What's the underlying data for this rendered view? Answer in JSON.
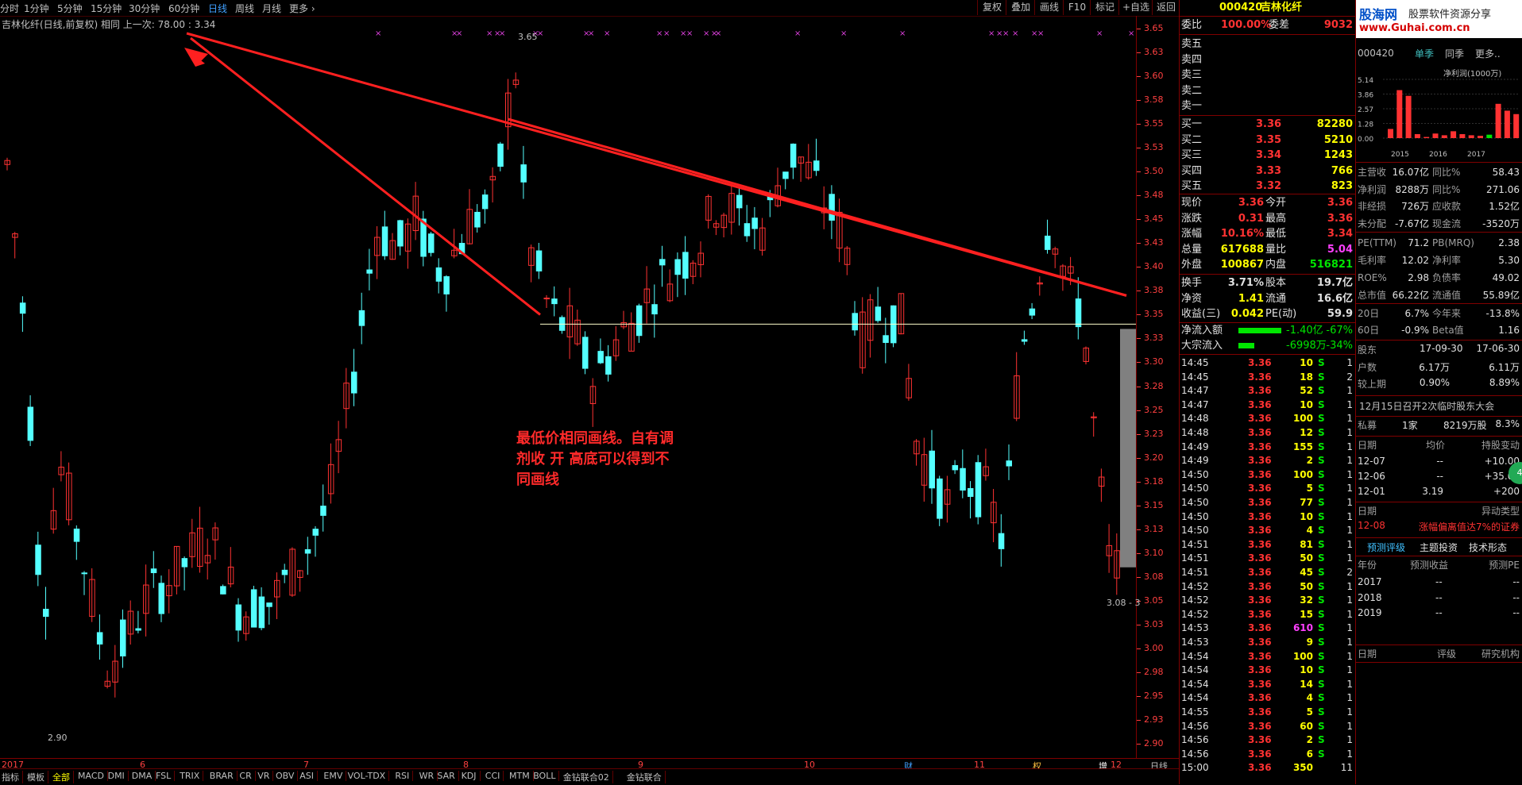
{
  "toolbar": {
    "periods": [
      "分时",
      "1分钟",
      "5分钟",
      "15分钟",
      "30分钟",
      "60分钟",
      "日线",
      "周线",
      "月线",
      "更多"
    ],
    "active_period": "日线",
    "buttons": [
      "复权",
      "叠加",
      "画线",
      "F10",
      "标记",
      "+自选",
      "返回"
    ]
  },
  "chart": {
    "info": "吉林化纤(日线,前复权) 相同 上一次: 78.00 : 3.34",
    "high_label": "3.65",
    "low_label": "2.90",
    "box_label": "3.08 - 3",
    "annotation": "最低价相同画线。自有调剂收 开 高底可以得到不同画线",
    "y_axis": [
      "3.65",
      "3.63",
      "3.60",
      "3.58",
      "3.55",
      "3.53",
      "3.50",
      "3.48",
      "3.45",
      "3.43",
      "3.40",
      "3.38",
      "3.35",
      "3.33",
      "3.30",
      "3.28",
      "3.25",
      "3.23",
      "3.20",
      "3.18",
      "3.15",
      "3.13",
      "3.10",
      "3.08",
      "3.05",
      "3.03",
      "3.00",
      "2.98",
      "2.95",
      "2.93",
      "2.90"
    ],
    "x_axis": [
      "2017年",
      "6",
      "7",
      "8",
      "9",
      "10",
      "11",
      "12"
    ],
    "x_markers": [
      "财",
      "权",
      "增减"
    ],
    "corner_label": "日线",
    "colors": {
      "up": "#ff3232",
      "down": "#54ffff",
      "trendline": "#ff2020",
      "hline": "#ffffcc"
    }
  },
  "indicators": [
    "指标",
    "模板",
    "全部",
    "MACD",
    "DMI",
    "DMA",
    "FSL",
    "TRIX",
    "BRAR",
    "CR",
    "VR",
    "OBV",
    "ASI",
    "EMV",
    "VOL-TDX",
    "RSI",
    "WR",
    "SAR",
    "KDJ",
    "CCI",
    "MTM",
    "BOLL",
    "金钻联合02",
    "金钻联合"
  ],
  "quote": {
    "code": "000420",
    "name": "吉林化纤",
    "webi_label": "委比",
    "webi_value": "100.00%",
    "wecha_label": "委差",
    "wecha_value": "9032",
    "sells": [
      {
        "label": "卖五"
      },
      {
        "label": "卖四"
      },
      {
        "label": "卖三"
      },
      {
        "label": "卖二"
      },
      {
        "label": "卖一"
      }
    ],
    "buys": [
      {
        "label": "买一",
        "price": "3.36",
        "vol": "82280"
      },
      {
        "label": "买二",
        "price": "3.35",
        "vol": "5210"
      },
      {
        "label": "买三",
        "price": "3.34",
        "vol": "1243"
      },
      {
        "label": "买四",
        "price": "3.33",
        "vol": "766"
      },
      {
        "label": "买五",
        "price": "3.32",
        "vol": "823"
      }
    ],
    "stats": [
      {
        "l1": "现价",
        "v1": "3.36",
        "l2": "今开",
        "v2": "3.36"
      },
      {
        "l1": "涨跌",
        "v1": "0.31",
        "l2": "最高",
        "v2": "3.36"
      },
      {
        "l1": "涨幅",
        "v1": "10.16%",
        "l2": "最低",
        "v2": "3.34"
      },
      {
        "l1": "总量",
        "v1": "617688",
        "l2": "量比",
        "v2": "5.04"
      },
      {
        "l1": "外盘",
        "v1": "100867",
        "l2": "内盘",
        "v2": "516821"
      }
    ],
    "stats2": [
      {
        "l1": "换手",
        "v1": "3.71%",
        "l2": "股本",
        "v2": "19.7亿"
      },
      {
        "l1": "净资",
        "v1": "1.41",
        "l2": "流通",
        "v2": "16.6亿"
      },
      {
        "l1": "收益(三)",
        "v1": "0.042",
        "l2": "PE(动)",
        "v2": "59.9"
      }
    ],
    "flow": [
      {
        "label": "净流入额",
        "value": "-1.40亿",
        "pct": "-67%"
      },
      {
        "label": "大宗流入",
        "value": "-6998万",
        "pct": "-34%"
      }
    ],
    "ticks": [
      {
        "t": "14:45",
        "p": "3.36",
        "v": "10",
        "s": "S",
        "n": "1"
      },
      {
        "t": "14:45",
        "p": "3.36",
        "v": "18",
        "s": "S",
        "n": "2"
      },
      {
        "t": "14:47",
        "p": "3.36",
        "v": "52",
        "s": "S",
        "n": "1"
      },
      {
        "t": "14:47",
        "p": "3.36",
        "v": "10",
        "s": "S",
        "n": "1"
      },
      {
        "t": "14:48",
        "p": "3.36",
        "v": "100",
        "s": "S",
        "n": "1"
      },
      {
        "t": "14:48",
        "p": "3.36",
        "v": "12",
        "s": "S",
        "n": "1"
      },
      {
        "t": "14:49",
        "p": "3.36",
        "v": "155",
        "s": "S",
        "n": "1"
      },
      {
        "t": "14:49",
        "p": "3.36",
        "v": "2",
        "s": "S",
        "n": "1"
      },
      {
        "t": "14:50",
        "p": "3.36",
        "v": "100",
        "s": "S",
        "n": "1"
      },
      {
        "t": "14:50",
        "p": "3.36",
        "v": "5",
        "s": "S",
        "n": "1"
      },
      {
        "t": "14:50",
        "p": "3.36",
        "v": "77",
        "s": "S",
        "n": "1"
      },
      {
        "t": "14:50",
        "p": "3.36",
        "v": "10",
        "s": "S",
        "n": "1"
      },
      {
        "t": "14:50",
        "p": "3.36",
        "v": "4",
        "s": "S",
        "n": "1"
      },
      {
        "t": "14:51",
        "p": "3.36",
        "v": "81",
        "s": "S",
        "n": "1"
      },
      {
        "t": "14:51",
        "p": "3.36",
        "v": "50",
        "s": "S",
        "n": "1"
      },
      {
        "t": "14:51",
        "p": "3.36",
        "v": "45",
        "s": "S",
        "n": "2"
      },
      {
        "t": "14:52",
        "p": "3.36",
        "v": "50",
        "s": "S",
        "n": "1"
      },
      {
        "t": "14:52",
        "p": "3.36",
        "v": "32",
        "s": "S",
        "n": "1"
      },
      {
        "t": "14:52",
        "p": "3.36",
        "v": "15",
        "s": "S",
        "n": "1"
      },
      {
        "t": "14:53",
        "p": "3.36",
        "v": "610",
        "s": "S",
        "n": "1"
      },
      {
        "t": "14:53",
        "p": "3.36",
        "v": "9",
        "s": "S",
        "n": "1"
      },
      {
        "t": "14:54",
        "p": "3.36",
        "v": "100",
        "s": "S",
        "n": "1"
      },
      {
        "t": "14:54",
        "p": "3.36",
        "v": "10",
        "s": "S",
        "n": "1"
      },
      {
        "t": "14:54",
        "p": "3.36",
        "v": "14",
        "s": "S",
        "n": "1"
      },
      {
        "t": "14:54",
        "p": "3.36",
        "v": "4",
        "s": "S",
        "n": "1"
      },
      {
        "t": "14:55",
        "p": "3.36",
        "v": "5",
        "s": "S",
        "n": "1"
      },
      {
        "t": "14:56",
        "p": "3.36",
        "v": "60",
        "s": "S",
        "n": "1"
      },
      {
        "t": "14:56",
        "p": "3.36",
        "v": "2",
        "s": "S",
        "n": "1"
      },
      {
        "t": "14:56",
        "p": "3.36",
        "v": "6",
        "s": "S",
        "n": "1"
      },
      {
        "t": "15:00",
        "p": "3.36",
        "v": "350",
        "s": "",
        "n": "11"
      }
    ]
  },
  "f10": {
    "logo_site": "股海网",
    "logo_slogan": "股票软件资源分享",
    "logo_url": "www.Guhai.com.cn",
    "code": "000420",
    "tabs": [
      "单季",
      "同季",
      "更多.."
    ],
    "chart_title": "净利润(1000万)",
    "chart_y": [
      "5.14",
      "3.86",
      "2.57",
      "1.28",
      "0.00"
    ],
    "chart_x": [
      "2015",
      "2016",
      "2017"
    ],
    "bars": [
      {
        "v": 0.8,
        "c": "#ff3232"
      },
      {
        "v": 4.2,
        "c": "#ff3232"
      },
      {
        "v": 3.7,
        "c": "#ff3232"
      },
      {
        "v": 0.35,
        "c": "#ff3232"
      },
      {
        "v": 0.1,
        "c": "#ff3232"
      },
      {
        "v": 0.4,
        "c": "#ff3232"
      },
      {
        "v": 0.25,
        "c": "#ff3232"
      },
      {
        "v": 0.6,
        "c": "#ff3232"
      },
      {
        "v": 0.35,
        "c": "#ff3232"
      },
      {
        "v": 0.25,
        "c": "#ff3232"
      },
      {
        "v": 0.2,
        "c": "#ff3232"
      },
      {
        "v": 0.3,
        "c": "#00e600"
      },
      {
        "v": 3.0,
        "c": "#ff3232"
      },
      {
        "v": 2.4,
        "c": "#ff3232"
      },
      {
        "v": 2.1,
        "c": "#ff3232"
      }
    ],
    "fin": [
      {
        "l1": "主营收",
        "v1": "16.07亿",
        "l2": "同比%",
        "v2": "58.43"
      },
      {
        "l1": "净利润",
        "v1": "8288万",
        "l2": "同比%",
        "v2": "271.06"
      },
      {
        "l1": "非经损",
        "v1": "726万",
        "l2": "应收款",
        "v2": "1.52亿"
      },
      {
        "l1": "未分配",
        "v1": "-7.67亿",
        "l2": "现金流",
        "v2": "-3520万"
      }
    ],
    "val": [
      {
        "l1": "PE(TTM)",
        "v1": "71.2",
        "l2": "PB(MRQ)",
        "v2": "2.38"
      },
      {
        "l1": "毛利率",
        "v1": "12.02",
        "l2": "净利率",
        "v2": "5.30"
      },
      {
        "l1": "ROE%",
        "v1": "2.98",
        "l2": "负债率",
        "v2": "49.02"
      },
      {
        "l1": "总市值",
        "v1": "66.22亿",
        "l2": "流通值",
        "v2": "55.89亿"
      }
    ],
    "perf": [
      {
        "l1": "20日",
        "v1": "6.7%",
        "l2": "今年来",
        "v2": "-13.8%"
      },
      {
        "l1": "60日",
        "v1": "-0.9%",
        "l2": "Beta值",
        "v2": "1.16"
      }
    ],
    "holders": {
      "label": "股东",
      "d1": "17-09-30",
      "d2": "17-06-30",
      "rows": [
        {
          "l": "户数",
          "a": "6.17万",
          "b": "6.11万"
        },
        {
          "l": "较上期",
          "a": "0.90%",
          "b": "8.89%"
        }
      ]
    },
    "notice": "12月15日召开2次临时股东大会",
    "private": {
      "l": "私募",
      "a": "1家",
      "b": "8219万股",
      "c": "8.3%"
    },
    "holdchange": {
      "h": [
        "日期",
        "均价",
        "持股变动"
      ],
      "rows": [
        [
          "12-07",
          "--",
          "+10.00"
        ],
        [
          "12-06",
          "--",
          "+35.00"
        ],
        [
          "12-01",
          "3.19",
          "+200"
        ]
      ]
    },
    "anomaly": {
      "h": [
        "日期",
        "异动类型"
      ],
      "rows": [
        [
          "12-08",
          "涨幅偏离值达7%的证券"
        ]
      ]
    },
    "fc_tabs": [
      "预测评级",
      "主题投资",
      "技术形态"
    ],
    "forecast": {
      "h": [
        "年份",
        "预测收益",
        "预测PE"
      ],
      "rows": [
        [
          "2017",
          "--",
          "--"
        ],
        [
          "2018",
          "--",
          "--"
        ],
        [
          "2019",
          "--",
          "--"
        ]
      ]
    },
    "rating_h": [
      "日期",
      "评级",
      "研究机构"
    ],
    "round_badge": "4"
  }
}
